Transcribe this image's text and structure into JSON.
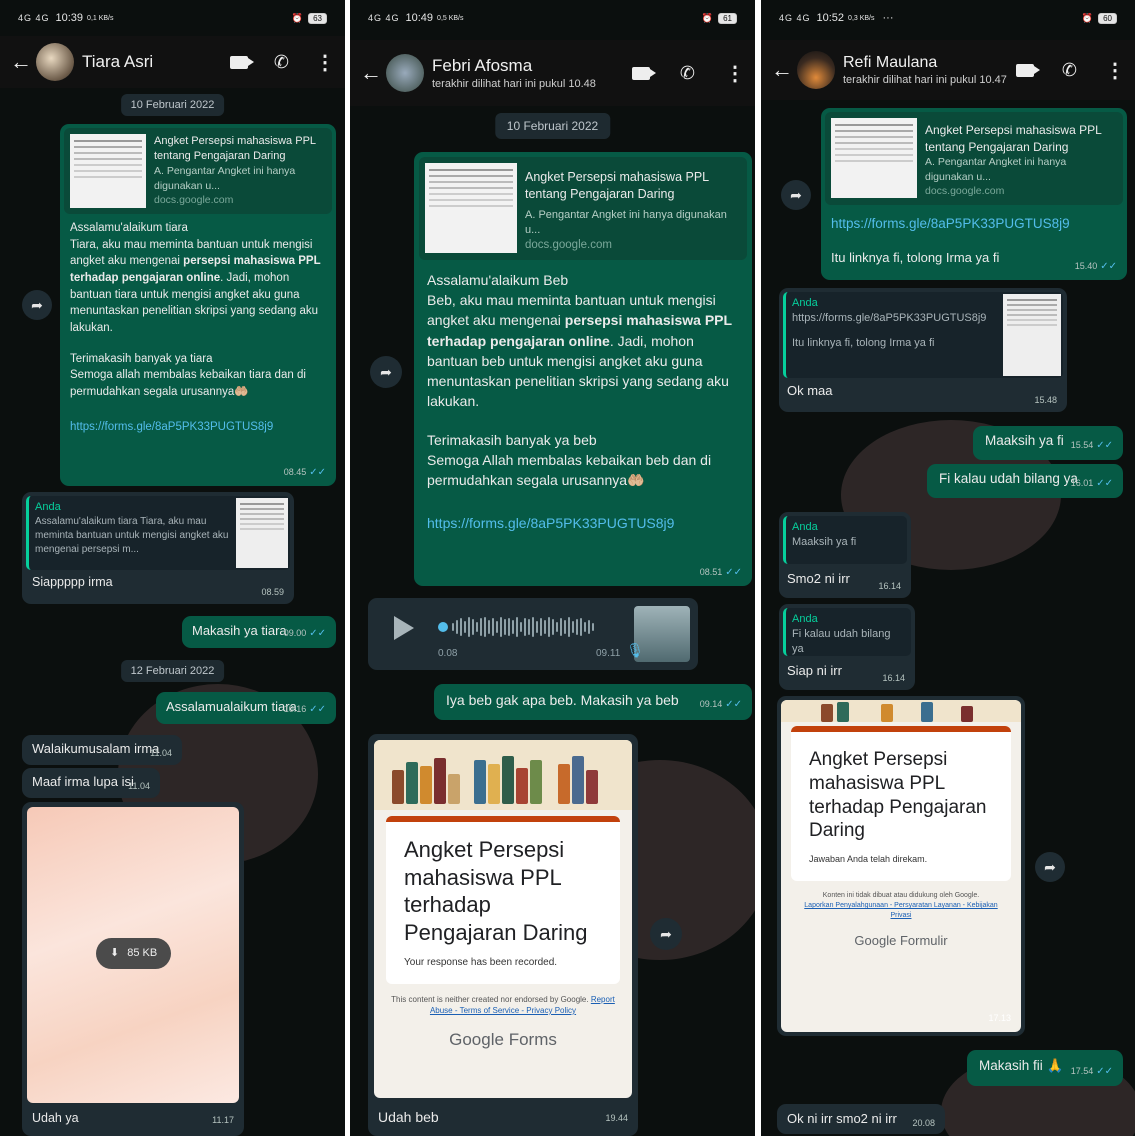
{
  "p1": {
    "status": {
      "signal": "4G 4G",
      "time": "10:39",
      "speed": "0,1 KB/s",
      "battery": "63"
    },
    "header": {
      "name": "Tiara Asri"
    },
    "date1": "10 Februari 2022",
    "link_preview": {
      "title": "Angket Persepsi mahasiswa PPL tentang Pengajaran Daring",
      "desc": "A. Pengantar Angket ini hanya digunakan u...",
      "domain": "docs.google.com"
    },
    "msg1": {
      "greet": "Assalamu'alaikum tiara",
      "body1": "Tiara, aku mau meminta bantuan untuk mengisi angket aku mengenai ",
      "bold": "persepsi mahasiswa PPL terhadap pengajaran online",
      "body2": ". Jadi, mohon bantuan tiara untuk mengisi angket aku guna menuntaskan penelitian skripsi yang sedang aku lakukan.",
      "thanks1": "Terimakasih banyak ya tiara",
      "thanks2": "Semoga allah membalas kebaikan tiara dan di permudahkan segala urusannya🤲🏼",
      "link": "https://forms.gle/8aP5PK33PUGTUS8j9",
      "time": "08.45"
    },
    "reply1": {
      "quote_who": "Anda",
      "quote_text": "Assalamu'alaikum tiara Tiara, aku mau meminta bantuan untuk mengisi angket aku mengenai persepsi m...",
      "text": "Siappppp irma",
      "time": "08.59"
    },
    "out2": {
      "text": "Makasih ya tiara",
      "time": "09.00"
    },
    "date2": "12 Februari 2022",
    "out3": {
      "text": "Assalamualaikum tiara",
      "time": "10.16"
    },
    "in3": {
      "text": "Walaikumusalam irma",
      "time": "11.04"
    },
    "in4": {
      "text": "Maaf irma lupa isi",
      "time": "11.04"
    },
    "img": {
      "size": "85 KB",
      "caption": "Udah ya",
      "time": "11.17"
    }
  },
  "p2": {
    "status": {
      "signal": "4G 4G",
      "time": "10:49",
      "speed": "0,5 KB/s",
      "battery": "61"
    },
    "header": {
      "name": "Febri Afosma",
      "sub": "terakhir dilihat hari ini pukul 10.48"
    },
    "date1": "10 Februari 2022",
    "link_preview": {
      "title": "Angket Persepsi mahasiswa PPL tentang Pengajaran Daring",
      "desc": "A. Pengantar Angket ini hanya digunakan u...",
      "domain": "docs.google.com"
    },
    "msg1": {
      "greet": "Assalamu'alaikum Beb",
      "body1": "Beb, aku mau meminta bantuan untuk mengisi angket aku mengenai ",
      "bold": "persepsi mahasiswa PPL terhadap pengajaran online",
      "body2": ". Jadi, mohon bantuan beb untuk mengisi angket aku guna menuntaskan penelitian skripsi yang sedang aku lakukan.",
      "thanks1": "Terimakasih banyak ya beb",
      "thanks2": "Semoga Allah membalas kebaikan beb dan di permudahkan segala urusannya🤲🏼",
      "link": "https://forms.gle/8aP5PK33PUGTUS8j9",
      "time": "08.51"
    },
    "voice": {
      "elapsed": "0.08",
      "time": "09.11"
    },
    "out2": {
      "text": "Iya beb gak apa beb. Makasih ya beb",
      "time": "09.14"
    },
    "form": {
      "title": "Angket Persepsi mahasiswa PPL terhadap Pengajaran Daring",
      "recorded": "Your response has been recorded.",
      "footer1": "This content is neither created nor endorsed by Google. ",
      "footer_links": "Report Abuse - Terms of Service - Privacy Policy",
      "brand1": "Google",
      "brand2": "Forms"
    },
    "caption": {
      "text": "Udah beb",
      "time": "19.44"
    }
  },
  "p3": {
    "status": {
      "signal": "4G 4G",
      "time": "10:52",
      "speed": "0,3 KB/s",
      "extra": "···",
      "battery": "60"
    },
    "header": {
      "name": "Refi Maulana",
      "sub": "terakhir dilihat hari ini pukul 10.47"
    },
    "link_preview": {
      "title": "Angket Persepsi mahasiswa PPL tentang Pengajaran Daring",
      "desc": "A. Pengantar Angket ini hanya digunakan u...",
      "domain": "docs.google.com"
    },
    "msg1": {
      "link": "https://forms.gle/8aP5PK33PUGTUS8j9",
      "text": "Itu linknya fi, tolong Irma ya fi",
      "time": "15.40"
    },
    "reply1": {
      "quote_who": "Anda",
      "quote_link": "https://forms.gle/8aP5PK33PUGTUS8j9",
      "quote_text": "Itu linknya fi, tolong Irma ya fi",
      "text": "Ok maa",
      "time": "15.48"
    },
    "out2": {
      "text": "Maaksih ya fi",
      "time": "15.54"
    },
    "out3": {
      "text": "Fi kalau udah bilang ya",
      "time": "16.01"
    },
    "reply2": {
      "quote_who": "Anda",
      "quote_text": "Maaksih ya fi",
      "text": "Smo2 ni irr",
      "time": "16.14"
    },
    "reply3": {
      "quote_who": "Anda",
      "quote_text": "Fi kalau udah bilang ya",
      "text": "Siap ni irr",
      "time": "16.14"
    },
    "form": {
      "title": "Angket Persepsi mahasiswa PPL terhadap Pengajaran Daring",
      "recorded": "Jawaban Anda telah direkam.",
      "footer1": "Konten ini tidak dibuat atau didukung oleh Google.",
      "footer_links": "Laporkan Penyalahgunaan - Persyaratan Layanan - Kebijakan Privasi",
      "brand1": "Google",
      "brand2": "Formulir",
      "time": "17.13"
    },
    "out4": {
      "text": "Makasih fii 🙏",
      "time": "17.54"
    },
    "in5": {
      "text": "Ok ni irr smo2 ni irr",
      "time": "20.08"
    }
  }
}
